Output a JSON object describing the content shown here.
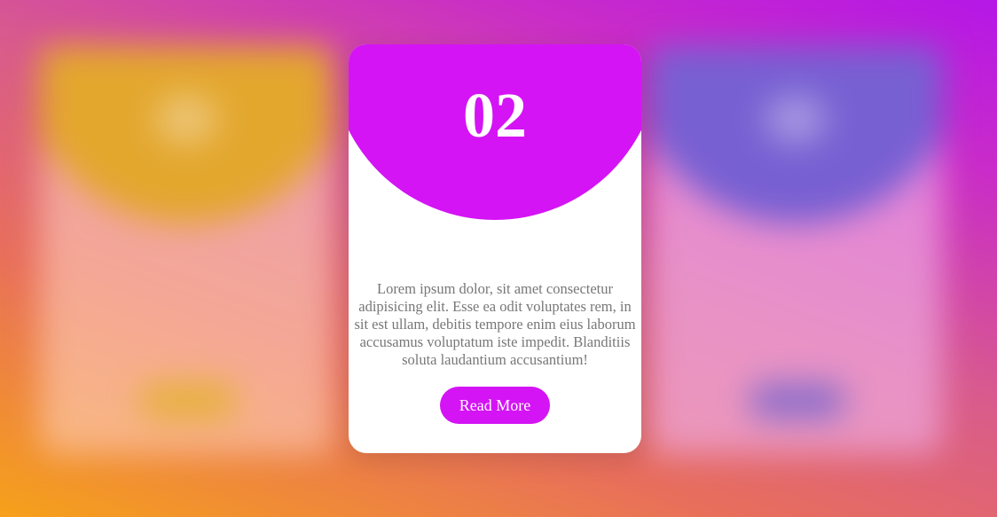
{
  "cards": {
    "center": {
      "number": "02",
      "text": "Lorem ipsum dolor, sit amet consectetur adipisicing elit. Esse ea odit voluptates rem, in sit est ullam, debitis tempore enim eius laborum accusamus voluptatum iste impedit. Blanditiis soluta laudantium accusantium!",
      "button_label": "Read More"
    }
  },
  "colors": {
    "center_accent": "#d414f5",
    "left_accent": "#e3a72e",
    "right_accent": "#7760d2"
  }
}
